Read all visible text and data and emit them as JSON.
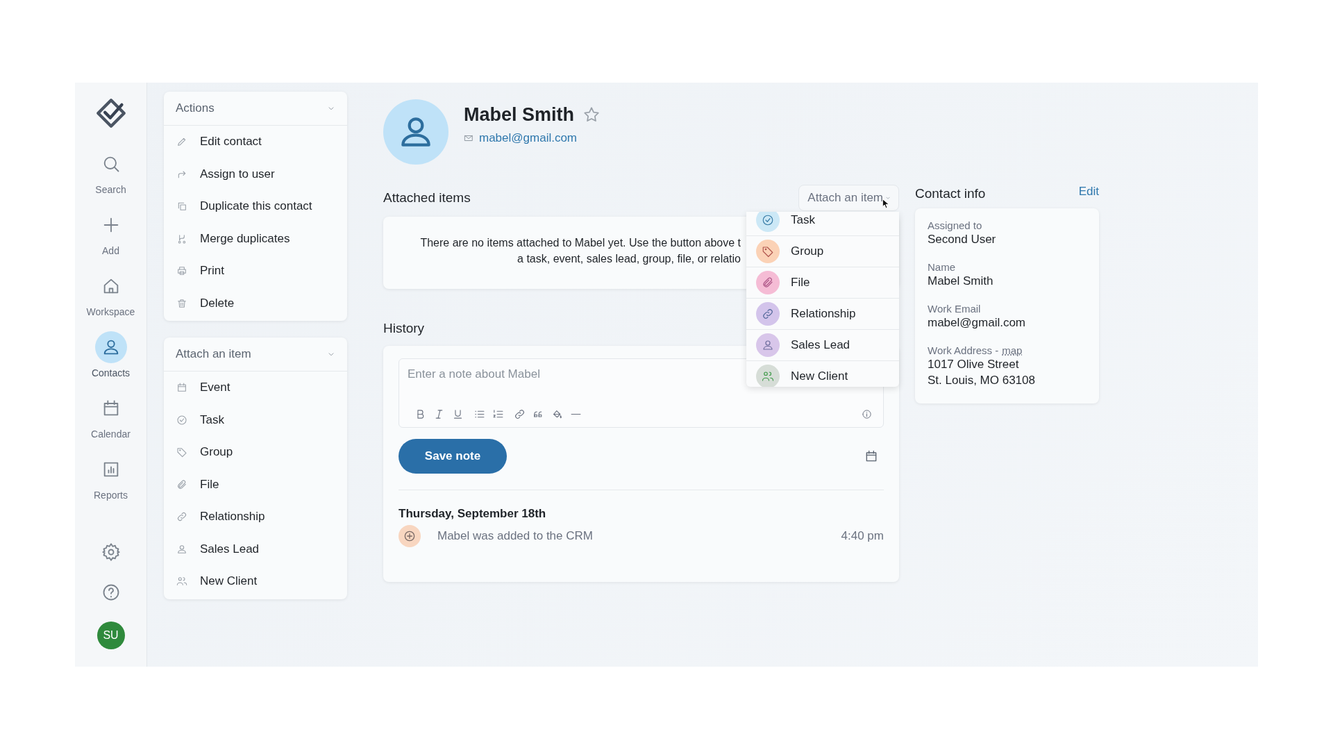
{
  "nav": {
    "items": [
      {
        "label": "Search",
        "selected": false
      },
      {
        "label": "Add",
        "selected": false
      },
      {
        "label": "Workspace",
        "selected": false
      },
      {
        "label": "Contacts",
        "selected": true
      },
      {
        "label": "Calendar",
        "selected": false
      },
      {
        "label": "Reports",
        "selected": false
      }
    ],
    "user_avatar": "SU"
  },
  "actions_panel": {
    "title": "Actions",
    "items": [
      "Edit contact",
      "Assign to user",
      "Duplicate this contact",
      "Merge duplicates",
      "Print",
      "Delete"
    ]
  },
  "attach_panel": {
    "title": "Attach an item",
    "items": [
      "Event",
      "Task",
      "Group",
      "File",
      "Relationship",
      "Sales Lead",
      "New Client"
    ]
  },
  "contact": {
    "name": "Mabel Smith",
    "starred": false,
    "email": "mabel@gmail.com"
  },
  "attached_items": {
    "title": "Attached items",
    "empty_message": [
      "There are no items attached to Mabel yet. Use the button above t",
      "a task, event, sales lead, group, file, or relatio"
    ],
    "attach_button": "Attach an item",
    "dropdown": [
      {
        "label": "Task",
        "color": "#cce8f6"
      },
      {
        "label": "Group",
        "color": "#fbd2b6"
      },
      {
        "label": "File",
        "color": "#f5bcd5"
      },
      {
        "label": "Relationship",
        "color": "#d3c4eb"
      },
      {
        "label": "Sales Lead",
        "color": "#d8c6ea"
      },
      {
        "label": "New Client",
        "color": "#d6ddd7"
      }
    ]
  },
  "history": {
    "title": "History",
    "note_placeholder": "Enter a note about Mabel",
    "save_button": "Save note",
    "entries": [
      {
        "date": "Thursday, September 18th",
        "events": [
          {
            "text": "Mabel was added to the CRM",
            "time": "4:40 pm"
          }
        ]
      }
    ]
  },
  "contact_info": {
    "title": "Contact info",
    "edit_link": "Edit",
    "fields": [
      {
        "label": "Assigned to",
        "value": [
          "Second User"
        ]
      },
      {
        "label": "Name",
        "value": [
          "Mabel Smith"
        ]
      },
      {
        "label": "Work Email",
        "value": [
          "mabel@gmail.com"
        ]
      },
      {
        "label": "Work Address -",
        "link": "map",
        "value": [
          "1017 Olive Street",
          "St. Louis, MO 63108"
        ]
      }
    ]
  }
}
